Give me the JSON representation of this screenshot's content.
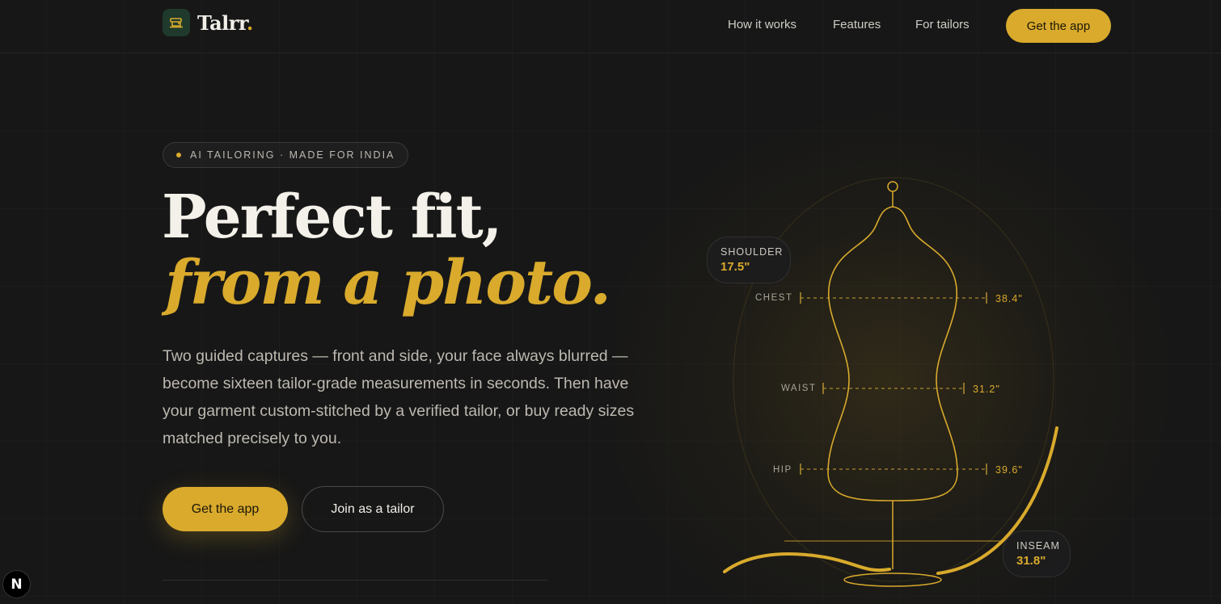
{
  "nav": {
    "brand": "Talrr",
    "brand_suffix": ".",
    "links": [
      "How it works",
      "Features",
      "For tailors"
    ],
    "cta": "Get the app"
  },
  "hero": {
    "eyebrow": "AI TAILORING · MADE FOR INDIA",
    "headline_line1": "Perfect fit,",
    "headline_line2": "from a photo.",
    "body": "Two guided captures — front and side, your face always blurred — become sixteen tailor-grade measurements in seconds. Then have your garment custom-stitched by a verified tailor, or buy ready sizes matched precisely to you.",
    "primary_cta": "Get the app",
    "secondary_cta": "Join as a tailor"
  },
  "figure": {
    "shoulder": {
      "label": "SHOULDER",
      "value": "17.5\""
    },
    "chest": {
      "label": "CHEST",
      "value": "38.4\""
    },
    "waist": {
      "label": "WAIST",
      "value": "31.2\""
    },
    "hip": {
      "label": "HIP",
      "value": "39.6\""
    },
    "inseam": {
      "label": "INSEAM",
      "value": "31.8\""
    }
  },
  "badge": "N",
  "colors": {
    "accent": "#d9aa2c",
    "background": "#171717",
    "logo_bg": "#1f3a2c"
  }
}
